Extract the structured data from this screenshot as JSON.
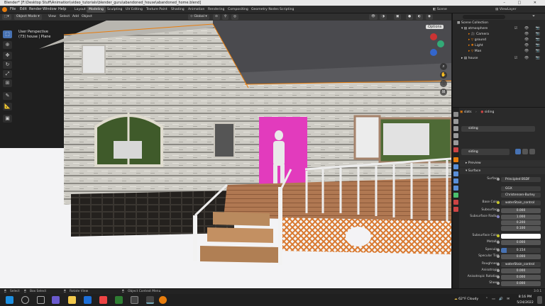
{
  "window": {
    "title": "Blender* [F:\\Desktop Stuff\\Animation\\video_tutorials\\blender_guru\\abandoned_house\\abandoned_home.blend]",
    "controls": [
      "–",
      "□",
      "✕"
    ]
  },
  "menu": [
    "File",
    "Edit",
    "Render",
    "Window",
    "Help"
  ],
  "workspaces": [
    "Layout",
    "Modeling",
    "Sculpting",
    "UV Editing",
    "Texture Paint",
    "Shading",
    "Animation",
    "Rendering",
    "Compositing",
    "Geometry Nodes",
    "Scripting"
  ],
  "active_workspace": "Modeling",
  "top_right": {
    "scene": "Scene",
    "view_layer": "ViewLayer"
  },
  "viewport_header": {
    "mode": "Object Mode",
    "menus": [
      "View",
      "Select",
      "Add",
      "Object"
    ],
    "transform": "Global",
    "options": "Options"
  },
  "viewport": {
    "perspective": "User Perspective",
    "collection": "(73) house | Plane"
  },
  "tools": [
    "select-box",
    "cursor",
    "move",
    "rotate",
    "scale",
    "transform",
    "annotate",
    "measure",
    "add-cube"
  ],
  "outliner": {
    "header": "Scene Collection",
    "items": [
      {
        "label": "Scene Collection",
        "indent": 0
      },
      {
        "label": "atmosphere",
        "indent": 1
      },
      {
        "label": "Camera",
        "indent": 2
      },
      {
        "label": "ground",
        "indent": 2
      },
      {
        "label": "Light",
        "indent": 2
      },
      {
        "label": "Man",
        "indent": 2
      },
      {
        "label": "house",
        "indent": 1
      }
    ]
  },
  "properties": {
    "breadcrumb_a": "slats",
    "breadcrumb_b": "siding",
    "slot": "siding",
    "material": "siding",
    "sections": {
      "preview": "Preview",
      "surface": "Surface"
    },
    "rows": [
      {
        "label": "Surface",
        "value": "Principled BSDF",
        "style": "dark",
        "dot": "g"
      },
      {
        "label": "",
        "value": "GGX",
        "style": "dark"
      },
      {
        "label": "",
        "value": "Christensen-Burley",
        "style": "dark"
      },
      {
        "label": "Base Color",
        "value": "waterStain_control",
        "style": "dark",
        "dot": "y"
      },
      {
        "label": "Subsurface",
        "value": "0.000"
      },
      {
        "label": "Subsurface Radius",
        "value": "1.000"
      },
      {
        "label": "",
        "value": "0.200"
      },
      {
        "label": "",
        "value": "0.100"
      },
      {
        "label": "Subsurface Color",
        "value": "",
        "style": "white",
        "dot": "y"
      },
      {
        "label": "Metallic",
        "value": "0.000"
      },
      {
        "label": "Specular",
        "value": "0.154",
        "style": "blue"
      },
      {
        "label": "Specular Tint",
        "value": "0.000"
      },
      {
        "label": "Roughness",
        "value": "waterStain_control",
        "style": "dark",
        "dot": "g"
      },
      {
        "label": "Anisotropic",
        "value": "0.000"
      },
      {
        "label": "Anisotropic Rotation",
        "value": "0.000"
      },
      {
        "label": "Sheen",
        "value": "0.000"
      }
    ]
  },
  "statusbar": {
    "select": "Select",
    "box_select": "Box Select",
    "rotate": "Rotate View",
    "context": "Object Context Menu",
    "version": "3.0.1"
  },
  "taskbar": {
    "weather": "62°F  Cloudy",
    "time": "8:16 PM",
    "date": "5/24/2022"
  },
  "colors": {
    "accent": "#4772b3",
    "blender_orange": "#e87d0d",
    "door_magenta": "#e23bbd",
    "lattice_orange": "#d9782e"
  }
}
